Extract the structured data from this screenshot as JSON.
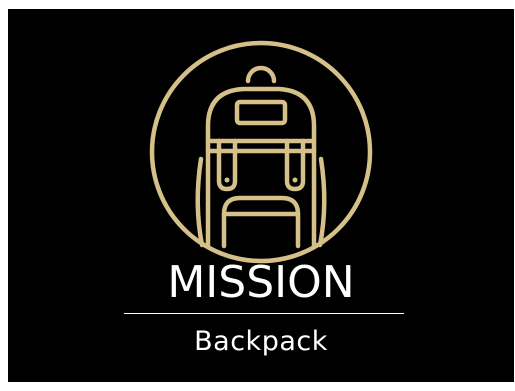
{
  "logo": {
    "title": "MISSION",
    "subtitle": "Backpack",
    "accent_color": "#d6c08a",
    "background_color": "#000000",
    "text_color": "#ffffff",
    "icon": "backpack-icon"
  }
}
